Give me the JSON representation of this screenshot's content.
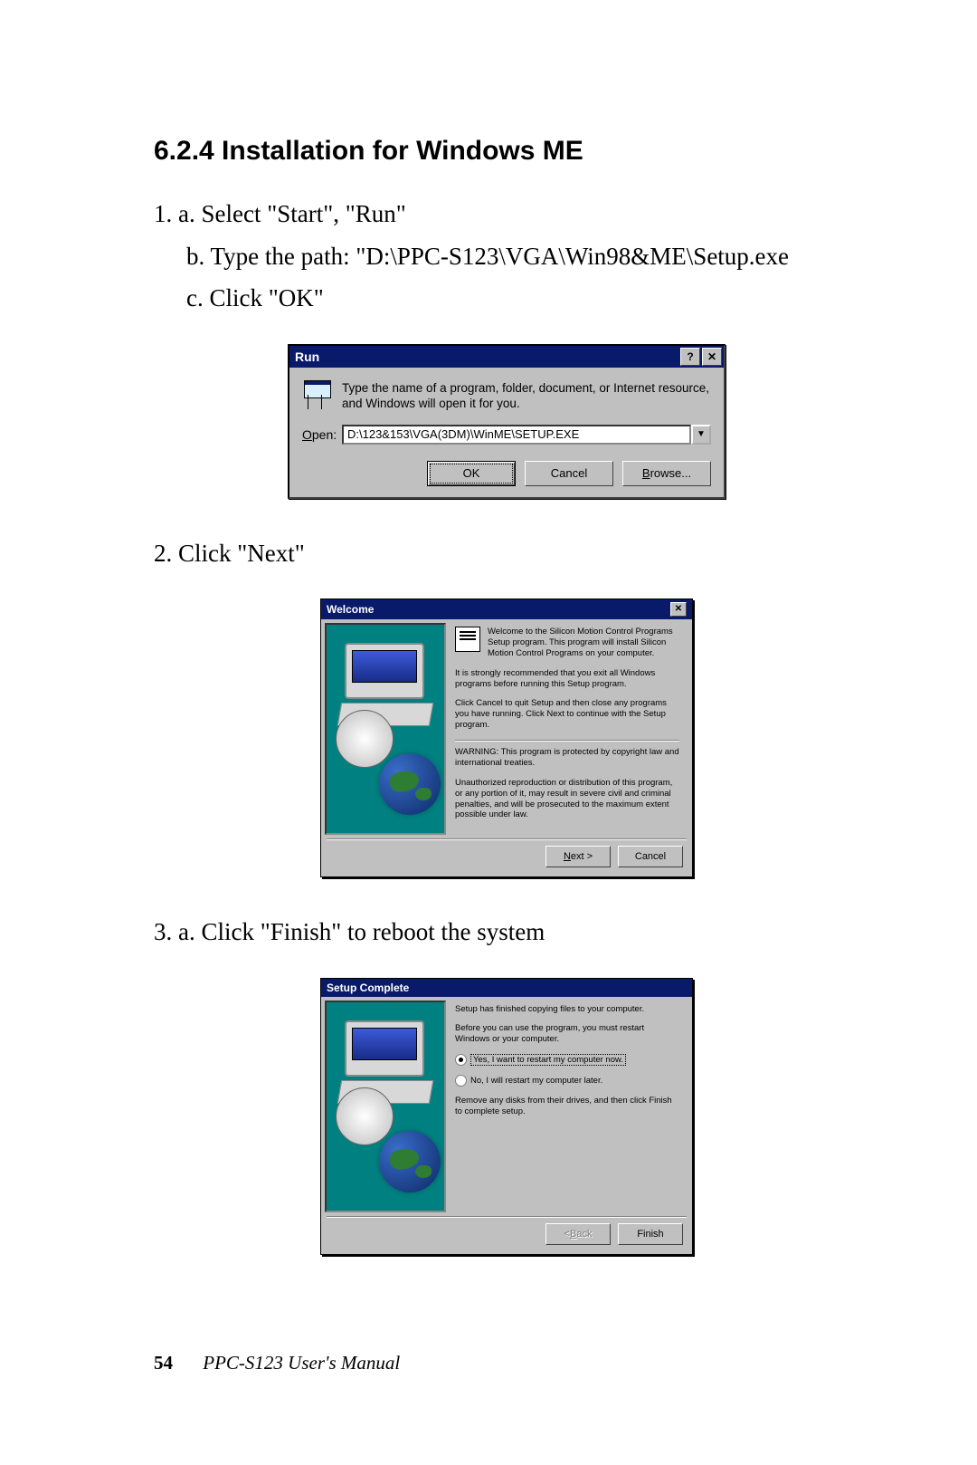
{
  "heading": "6.2.4 Installation for Windows ME",
  "step1": {
    "a": "1. a. Select \"Start\", \"Run\"",
    "b": "b. Type the path: \"D:\\PPC-S123\\VGA\\Win98&ME\\Setup.exe",
    "c": "c. Click \"OK\""
  },
  "run_dialog": {
    "title": "Run",
    "help_btn": "?",
    "close_btn": "✕",
    "description": "Type the name of a program, folder, document, or Internet resource, and Windows will open it for you.",
    "open_label_prefix": "O",
    "open_label_rest": "pen:",
    "input_value": "D:\\123&153\\VGA(3DM)\\WinME\\SETUP.EXE",
    "ok": "OK",
    "cancel": "Cancel",
    "browse_prefix": "B",
    "browse_rest": "rowse..."
  },
  "step2": "2. Click \"Next\"",
  "welcome_dialog": {
    "title": "Welcome",
    "close_btn": "✕",
    "p1": "Welcome to the Silicon Motion Control Programs Setup program. This program will install Silicon Motion Control Programs on your computer.",
    "p2": "It is strongly recommended that you exit all Windows programs before running this Setup program.",
    "p3": "Click Cancel to quit Setup and then close any programs you have running. Click Next to continue with the Setup program.",
    "p4": "WARNING: This program is protected by copyright law and international treaties.",
    "p5": "Unauthorized reproduction or distribution of this program, or any portion of it, may result in severe civil and criminal penalties, and will be prosecuted to the maximum extent possible under law.",
    "next_prefix": "N",
    "next_rest": "ext >",
    "cancel": "Cancel"
  },
  "step3": "3. a. Click \"Finish\" to reboot the system",
  "complete_dialog": {
    "title": "Setup Complete",
    "p1": "Setup has finished copying files to your computer.",
    "p2": "Before you can use the program, you must restart Windows or your computer.",
    "radio_yes": "Yes, I want to restart my computer now.",
    "radio_no": "No, I will restart my computer later.",
    "p3": "Remove any disks from their drives, and then click Finish to complete setup.",
    "back_prefix": "< ",
    "back_u": "B",
    "back_rest": "ack",
    "finish": "Finish"
  },
  "footer": {
    "page": "54",
    "book": "PPC-S123  User's Manual"
  }
}
